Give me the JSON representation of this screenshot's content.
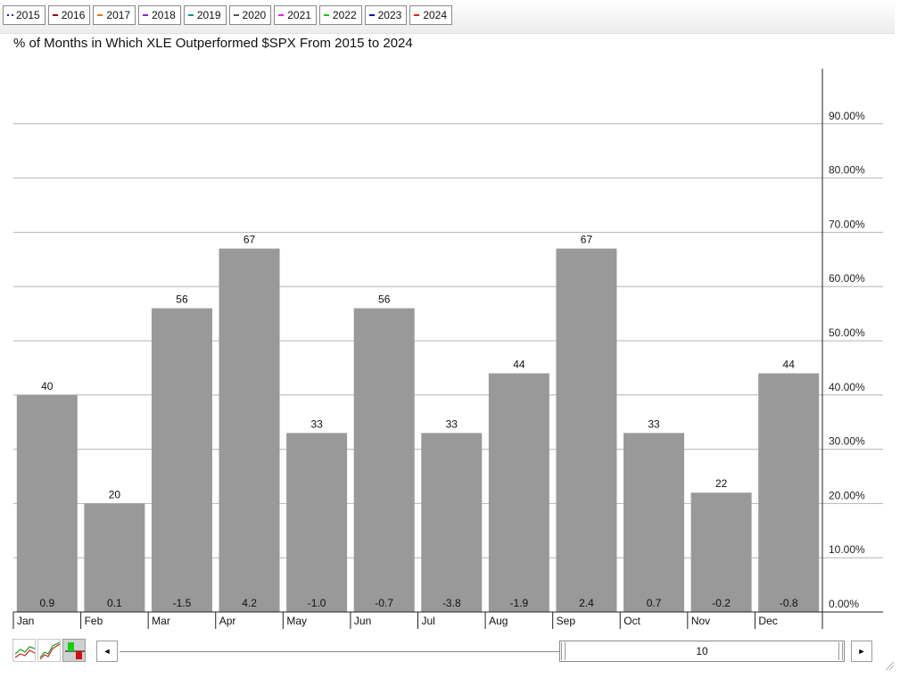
{
  "legend": {
    "items": [
      {
        "label": "2015",
        "color": "#1a1aa8",
        "style": "dotted"
      },
      {
        "label": "2016",
        "color": "#a40000",
        "style": "solid"
      },
      {
        "label": "2017",
        "color": "#f07010",
        "style": "solid"
      },
      {
        "label": "2018",
        "color": "#9020e0",
        "style": "solid"
      },
      {
        "label": "2019",
        "color": "#109090",
        "style": "solid"
      },
      {
        "label": "2020",
        "color": "#555555",
        "style": "solid"
      },
      {
        "label": "2021",
        "color": "#f020f0",
        "style": "solid"
      },
      {
        "label": "2022",
        "color": "#20c020",
        "style": "solid"
      },
      {
        "label": "2023",
        "color": "#1010c0",
        "style": "solid"
      },
      {
        "label": "2024",
        "color": "#e02020",
        "style": "solid"
      }
    ]
  },
  "chart_data": {
    "type": "bar",
    "title": "% of Months in Which XLE Outperformed $SPX From 2015 to 2024",
    "categories": [
      "Jan",
      "Feb",
      "Mar",
      "Apr",
      "May",
      "Jun",
      "Jul",
      "Aug",
      "Sep",
      "Oct",
      "Nov",
      "Dec"
    ],
    "series": [
      {
        "values": [
          40,
          20,
          56,
          67,
          33,
          56,
          33,
          44,
          67,
          33,
          22,
          44
        ],
        "labels": [
          "40",
          "20",
          "56",
          "67",
          "33",
          "56",
          "33",
          "44",
          "67",
          "33",
          "22",
          "44"
        ],
        "color": "#999999"
      }
    ],
    "inner_labels": [
      "0.9",
      "0.1",
      "-1.5",
      "4.2",
      "-1.0",
      "-0.7",
      "-3.8",
      "-1.9",
      "2.4",
      "0.7",
      "-0.2",
      "-0.8"
    ],
    "y_axis": {
      "ylim": [
        0,
        100
      ],
      "ticks": [
        0,
        10,
        20,
        30,
        40,
        50,
        60,
        70,
        80,
        90
      ],
      "tick_labels": [
        "0.00%",
        "10.00%",
        "20.00%",
        "30.00%",
        "40.00%",
        "50.00%",
        "60.00%",
        "70.00%",
        "80.00%",
        "90.00%"
      ],
      "position": "right"
    },
    "grid": true,
    "legend_position": "top"
  },
  "controls": {
    "scroll_left": "◄",
    "scroll_right": "►",
    "range_value": "10",
    "chart_type_buttons": [
      "line-chart-icon",
      "area-chart-icon",
      "bar-chart-icon"
    ]
  }
}
